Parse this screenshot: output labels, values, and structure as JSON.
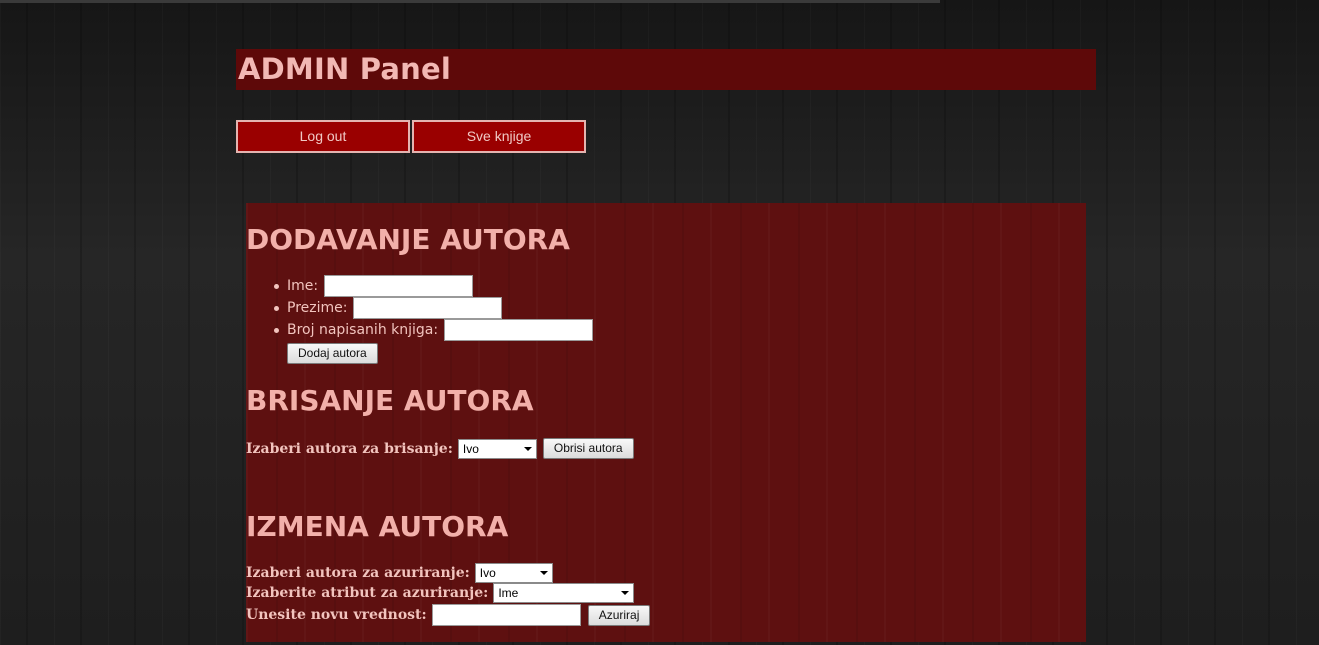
{
  "header": {
    "title": "ADMIN Panel"
  },
  "nav": {
    "logout_label": "Log out",
    "all_books_label": "Sve knjige"
  },
  "add_author": {
    "title": "DODAVANJE AUTORA",
    "first_name_label": "Ime:",
    "last_name_label": "Prezime:",
    "books_count_label": "Broj napisanih knjiga:",
    "first_name_value": "",
    "last_name_value": "",
    "books_count_value": "",
    "submit_label": "Dodaj autora"
  },
  "delete_author": {
    "title": "BRISANJE AUTORA",
    "select_label": "Izaberi autora za brisanje:",
    "selected_author": "Ivo",
    "submit_label": "Obrisi autora"
  },
  "update_author": {
    "title": "IZMENA AUTORA",
    "select_author_label": "Izaberi autora za azuriranje:",
    "selected_author": "Ivo",
    "select_attribute_label": "Izaberite atribut za azuriranje:",
    "selected_attribute": "Ime",
    "new_value_label": "Unesite novu vrednost:",
    "new_value": "",
    "submit_label": "Azuriraj"
  },
  "colors": {
    "header_bg": "#5e0909",
    "title_text": "#f2b8b4",
    "nav_bg": "#9a0000",
    "panel_bg": "#5e1010"
  }
}
